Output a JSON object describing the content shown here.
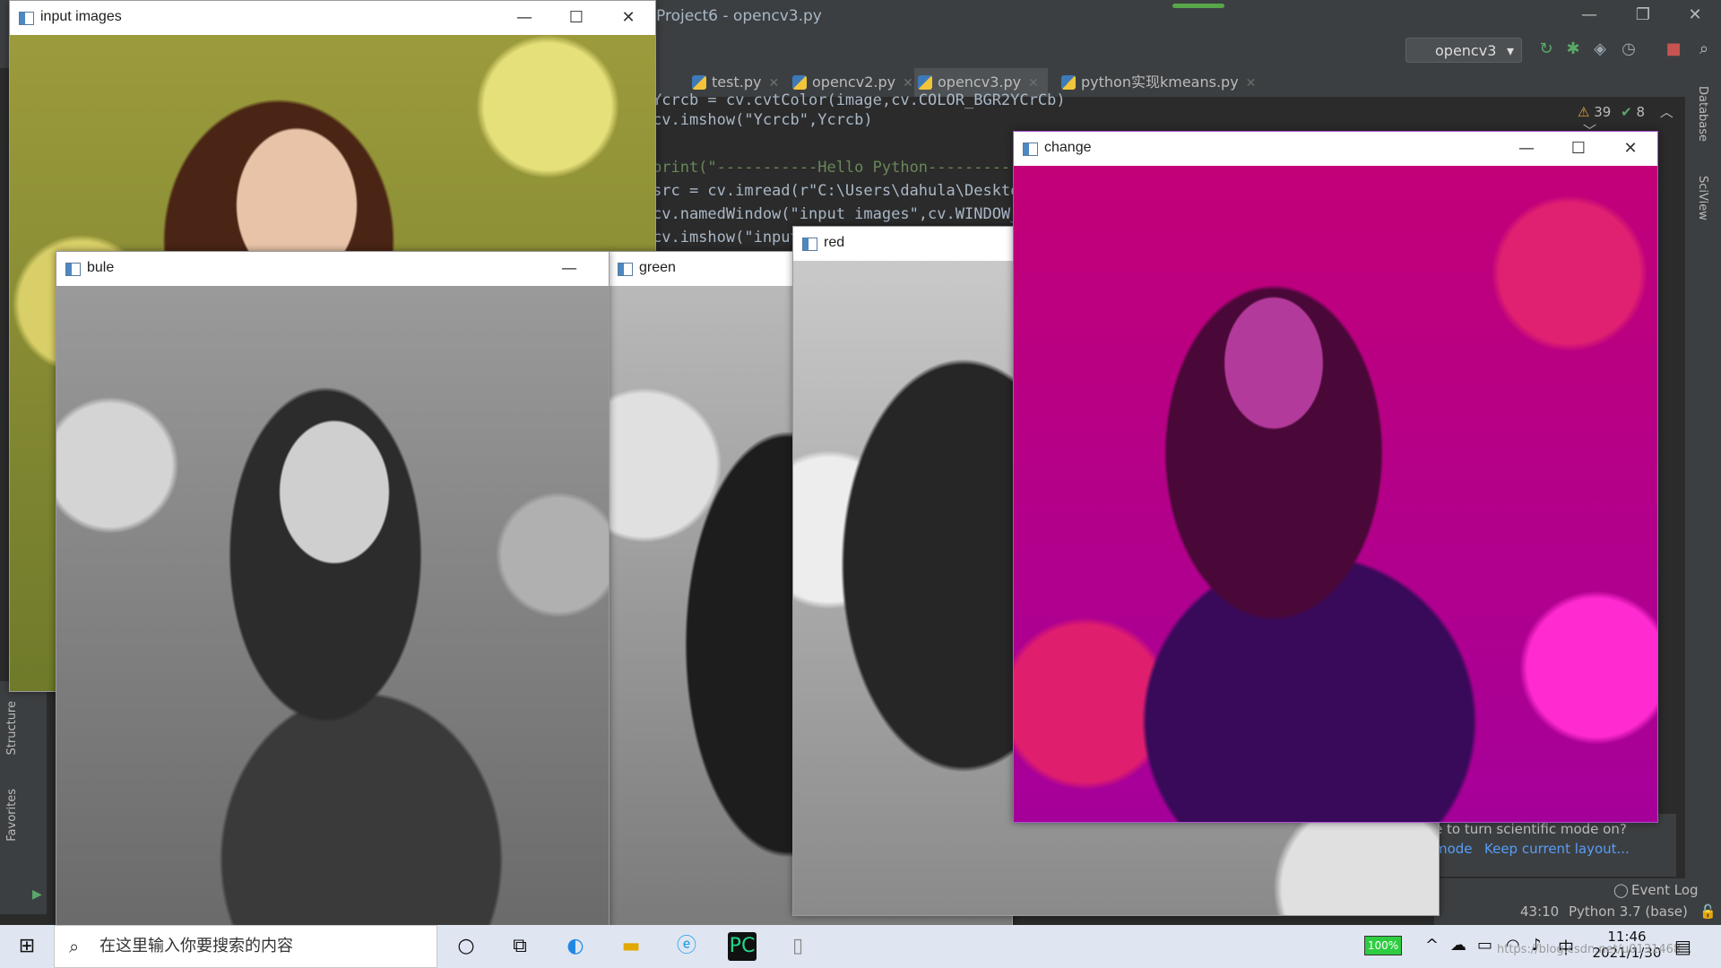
{
  "ide": {
    "title": "Project6 - opencv3.py",
    "run_config": "opencv3",
    "tabs": [
      {
        "label": "test.py"
      },
      {
        "label": "opencv2.py"
      },
      {
        "label": "opencv3.py"
      },
      {
        "label": "python实现kmeans.py"
      }
    ],
    "inspection_warnings": "39",
    "inspection_checks": "8",
    "code_lines": [
      "Ycrcb = cv.cvtColor(image,cv.COLOR_BGR2YCrCb)",
      "cv.imshow(\"Ycrcb\",Ycrcb)",
      "",
      "print(\"-----------Hello Python-----------\")",
      "src = cv.imread(r\"C:\\Users\\dahula\\Desktop\\ji",
      "cv.namedWindow(\"input images\",cv.WINDOW_AUTOS",
      "cv.imshow(\"input ima"
    ],
    "right_tools": [
      "Database",
      "SciView"
    ],
    "left_tools": [
      "Structure",
      "Favorites"
    ],
    "notification": {
      "line1": "e to turn scientific mode on?",
      "link1": "mode",
      "link2": "Keep current layout..."
    },
    "event_log": "Event Log",
    "status_position": "43:10",
    "status_interpreter": "Python 3.7 (base)"
  },
  "windows": {
    "input": {
      "title": "input images"
    },
    "blue": {
      "title": "bule"
    },
    "green": {
      "title": "green"
    },
    "red": {
      "title": "red"
    },
    "change": {
      "title": "change"
    }
  },
  "taskbar": {
    "search_placeholder": "在这里输入你要搜索的内容",
    "battery": "100%",
    "ime": "中",
    "time": "11:46",
    "date": "2021/1/30",
    "watermark": "https://blog.csdn.net/u0131468..."
  },
  "colors": {
    "ide_bg": "#2b2b2b",
    "change_magenta": "#c0007a",
    "taskbar": "#dfe6f2"
  }
}
